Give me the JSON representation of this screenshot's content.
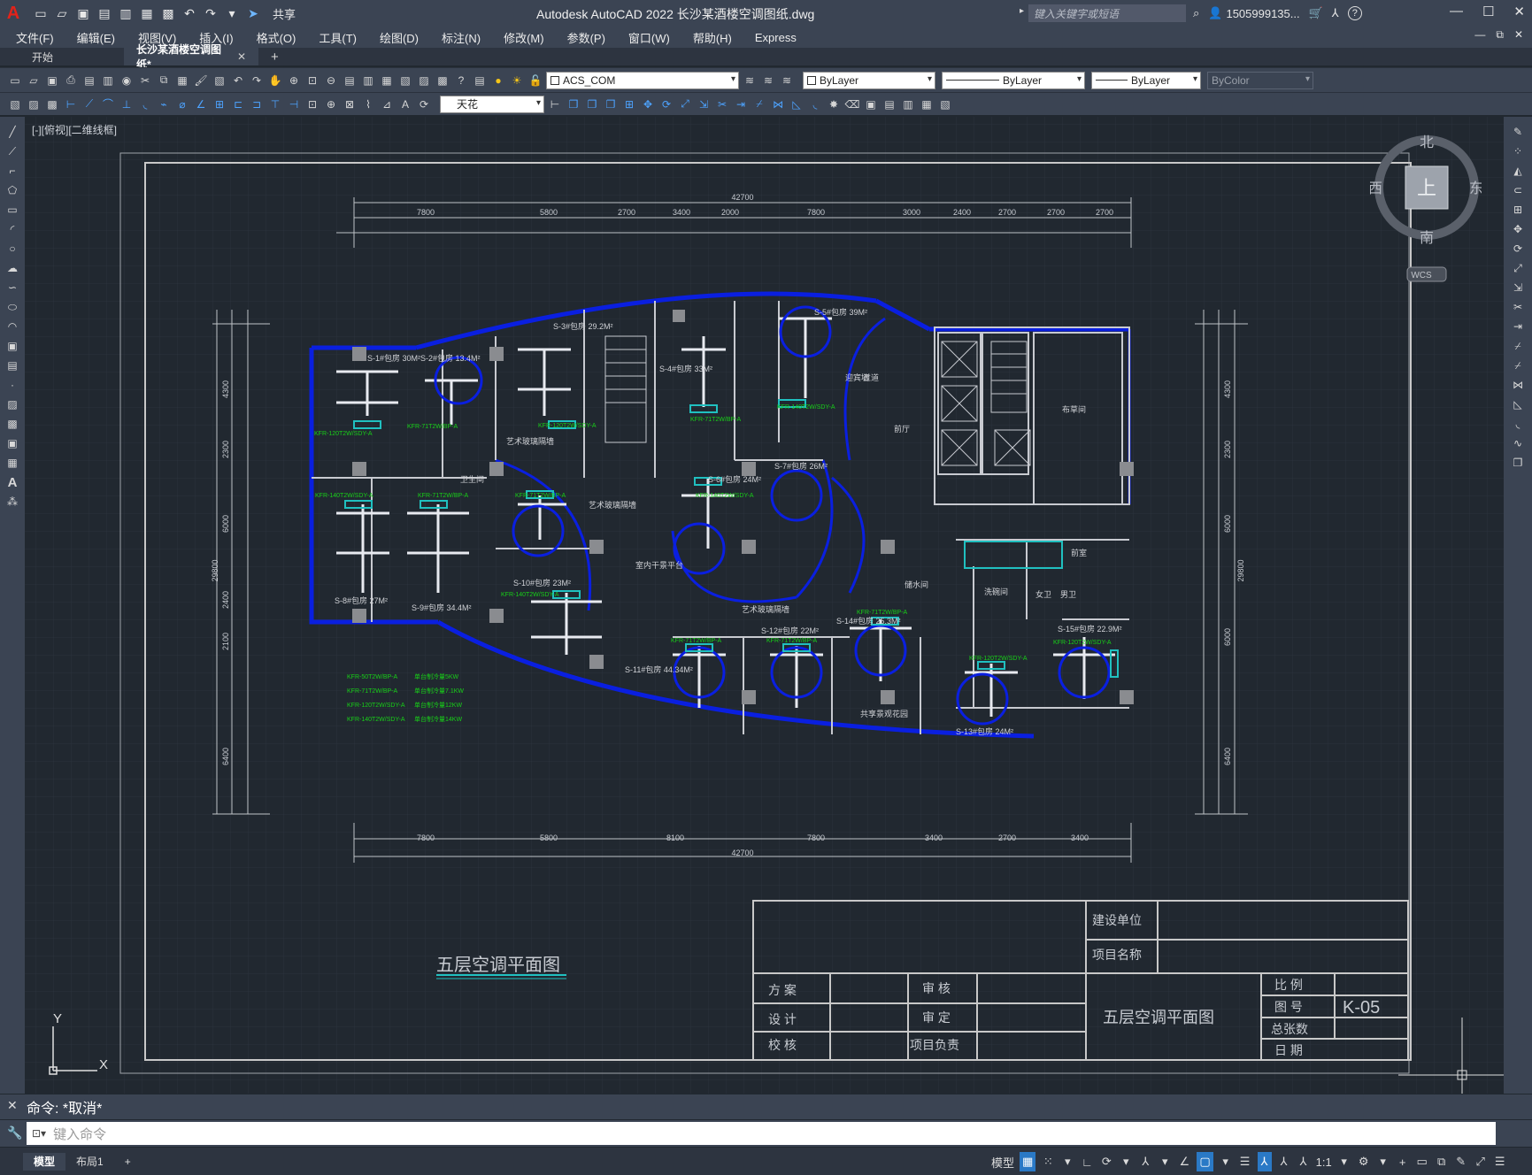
{
  "app": {
    "title": "Autodesk AutoCAD 2022    长沙某酒楼空调图纸.dwg",
    "logo": "A",
    "share_label": "共享",
    "search_placeholder": "键入关键字或短语",
    "user": "1505999135...",
    "help": "?"
  },
  "menus": [
    "文件(F)",
    "编辑(E)",
    "视图(V)",
    "插入(I)",
    "格式(O)",
    "工具(T)",
    "绘图(D)",
    "标注(N)",
    "修改(M)",
    "参数(P)",
    "窗口(W)",
    "帮助(H)",
    "Express"
  ],
  "tabs": {
    "start": "开始",
    "active": "长沙某酒楼空调图纸*",
    "add": "+"
  },
  "toolbar": {
    "layer": "ACS_COM",
    "color": "ByLayer",
    "linetype": "ByLayer",
    "lineweight": "ByLayer",
    "plotstyle": "ByColor",
    "textstyle": "天花"
  },
  "viewport": {
    "label": "[-][俯视][二维线框]"
  },
  "viewcube": {
    "north": "北",
    "south": "南",
    "west": "西",
    "east": "东",
    "top": "上",
    "wcs": "WCS"
  },
  "ucs": {
    "x": "X",
    "y": "Y"
  },
  "drawing": {
    "title": "五层空调平面图",
    "overall_dim": "42700",
    "top_dims": [
      "7800",
      "5800",
      "2700",
      "3400",
      "2000",
      "7800",
      "3000",
      "2400",
      "2700",
      "2700",
      "2700"
    ],
    "bottom_dims": [
      "7800",
      "5800",
      "8100",
      "7800",
      "3400",
      "2700",
      "3400"
    ],
    "left_dims": [
      "4300",
      "2300",
      "6000",
      "2400",
      "2100",
      "6400"
    ],
    "right_dims": [
      "4300",
      "2300",
      "6000",
      "6000",
      "6400"
    ],
    "total_height": "29800",
    "rooms": [
      {
        "name": "S-1#包房 30M²"
      },
      {
        "name": "S-2#包房 13.4M²"
      },
      {
        "name": "S-3#包房 29.2M²"
      },
      {
        "name": "S-4#包房 33M²"
      },
      {
        "name": "S-5#包房 39M²"
      },
      {
        "name": "S-6#包房 24M²"
      },
      {
        "name": "S-7#包房 26M²"
      },
      {
        "name": "S-8#包房 27M²"
      },
      {
        "name": "S-9#包房 34.4M²"
      },
      {
        "name": "S-10#包房 23M²"
      },
      {
        "name": "S-11#包房 44.34M²"
      },
      {
        "name": "S-12#包房 22M²"
      },
      {
        "name": "S-13#包房 24M²"
      },
      {
        "name": "S-14#包房 25.3M²"
      },
      {
        "name": "S-15#包房 22.9M²"
      }
    ],
    "labels": [
      "艺术玻璃隔墙",
      "艺术玻璃隔墙",
      "艺术玻璃隔墙",
      "室内干景平台",
      "前厅",
      "过道",
      "卫生间",
      "布草间",
      "储水间",
      "洗碗间",
      "男卫",
      "女卫",
      "前室",
      "共享景观花园",
      "迎宾墙"
    ],
    "legend": [
      {
        "model": "KFR-50T2W/BP-A",
        "note": "单台制冷量5KW"
      },
      {
        "model": "KFR-71T2W/BP-A",
        "note": "单台制冷量7.1KW"
      },
      {
        "model": "KFR-120T2W/SDY-A",
        "note": "单台制冷量12KW"
      },
      {
        "model": "KFR-140T2W/SDY-A",
        "note": "单台制冷量14KW"
      }
    ],
    "unit_labels": [
      "KFR-120T2W/SDY-A",
      "KFR-71T2W/BP-A",
      "KFR-120T2W/SDY-A",
      "KFR-71T2W/BP-A",
      "KFR-140T2W/SDY-A",
      "KFR-140T2W/SDY-A",
      "KFR-71T2W/BP-A",
      "KFR-71T2W/BP-A",
      "KFR-140T2W/SDY-A",
      "KFR-140T2W/SDY-A",
      "KFR-71T2W/BP-A",
      "KFR-71T2W/BP-A",
      "KFR-71T2W/BP-A",
      "KFR-120T2W/SDY-A",
      "KFR-120T2W/SDY-A"
    ]
  },
  "titleblock": {
    "construction_unit": "建设单位",
    "project_name": "项目名称",
    "scheme": "方 案",
    "design": "设 计",
    "check": "校 核",
    "review": "审 核",
    "approve": "审 定",
    "project_lead": "项目负责",
    "drawing_title": "五层空调平面图",
    "scale": "比 例",
    "drawing_no_label": "图 号",
    "drawing_no": "K-05",
    "total_sheets": "总张数",
    "date": "日 期"
  },
  "command": {
    "history": "命令: *取消*",
    "placeholder": "键入命令"
  },
  "status": {
    "model": "模型",
    "layout1": "布局1",
    "add": "+",
    "model_btn": "模型",
    "scale": "1:1"
  },
  "colors": {
    "chrome": "#3b4453",
    "canvas": "#212830",
    "wall": "#0a1fe0",
    "duct": "#e8eaf0",
    "unit": "#20c0c0",
    "legend": "#18d018",
    "frame": "#c8c8c8",
    "accent": "#2a79c6"
  }
}
